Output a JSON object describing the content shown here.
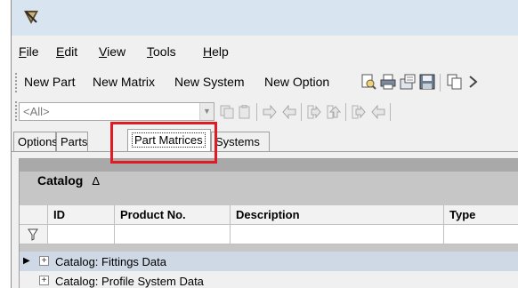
{
  "menu": [
    {
      "label": "File",
      "accel": "F"
    },
    {
      "label": "Edit",
      "accel": "E"
    },
    {
      "label": "View",
      "accel": "V"
    },
    {
      "label": "Tools",
      "accel": "T"
    },
    {
      "label": "Help",
      "accel": "H"
    }
  ],
  "toolbar": {
    "new_part": "New Part",
    "new_matrix": "New Matrix",
    "new_system": "New System",
    "new_option": "New Option",
    "icons": [
      "print-preview-icon",
      "print-icon",
      "import-icon",
      "save-icon",
      "copy-icon",
      "chevron-right-icon"
    ]
  },
  "filter": {
    "selected": "<All>"
  },
  "tabs": [
    {
      "label": "Options",
      "active": false
    },
    {
      "label": "Parts",
      "active": false
    },
    {
      "label": "Part Matrices",
      "active": true
    },
    {
      "label": "Systems",
      "active": false
    }
  ],
  "grid": {
    "group_by": "Catalog",
    "sort_indicator": "Δ",
    "columns": [
      "ID",
      "Product No.",
      "Description",
      "Type"
    ],
    "rows": [
      {
        "label": "Catalog: Fittings Data",
        "selected": true
      },
      {
        "label": "Catalog: Profile System Data",
        "selected": false
      }
    ]
  },
  "colors": {
    "highlight": "#e01b23",
    "selected_row": "#cfd9e6",
    "titlebar": "#d9e4f1"
  }
}
